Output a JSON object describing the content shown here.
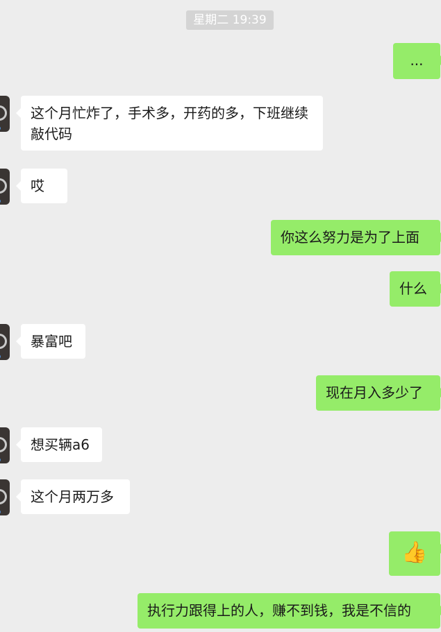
{
  "timestamp": "星期二 19:39",
  "messages": [
    {
      "side": "out",
      "text": "..."
    },
    {
      "side": "in",
      "text": "这个月忙炸了，手术多，开药的多，下班继续敲代码"
    },
    {
      "side": "in",
      "text": "哎"
    },
    {
      "side": "out",
      "text": "你这么努力是为了上面"
    },
    {
      "side": "out",
      "text": "什么"
    },
    {
      "side": "in",
      "text": "暴富吧"
    },
    {
      "side": "out",
      "text": "现在月入多少了"
    },
    {
      "side": "in",
      "text": "想买辆a6"
    },
    {
      "side": "in",
      "text": "这个月两万多"
    },
    {
      "side": "out",
      "text": "👍"
    },
    {
      "side": "out",
      "text": "执行力跟得上的人，赚不到钱，我是不信的"
    }
  ],
  "icons": {
    "avatar": "contact-avatar-icon",
    "thumbs_up": "thumbs-up-icon"
  },
  "colors": {
    "background": "#ededed",
    "incoming_bubble": "#ffffff",
    "outgoing_bubble": "#95ec69",
    "timestamp_bg": "#d4d4d4"
  }
}
